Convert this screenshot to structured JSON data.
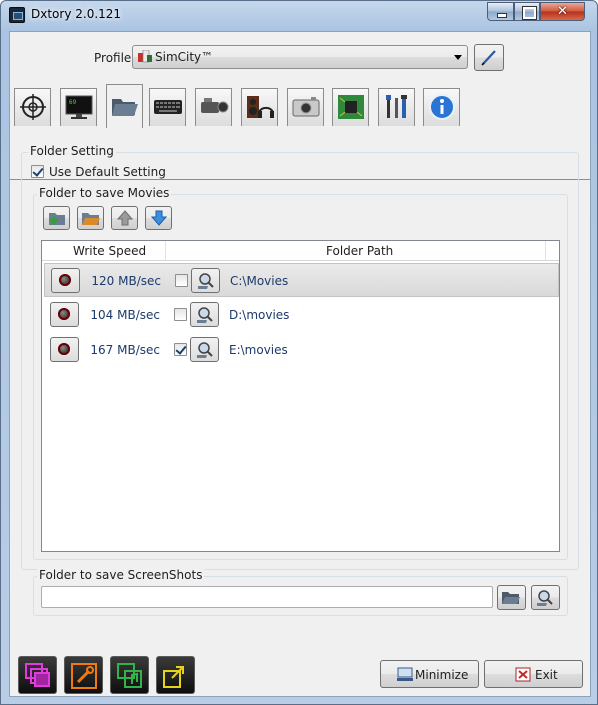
{
  "window": {
    "title": "Dxtory 2.0.121"
  },
  "profile": {
    "label": "Profile",
    "value": "SimCity™"
  },
  "tabs": [
    {
      "name": "capture-target-tab"
    },
    {
      "name": "display-overlay-tab"
    },
    {
      "name": "folder-tab",
      "active": true
    },
    {
      "name": "hotkey-tab"
    },
    {
      "name": "movie-setting-tab"
    },
    {
      "name": "audio-setting-tab"
    },
    {
      "name": "screenshot-setting-tab"
    },
    {
      "name": "advanced-setting-tab"
    },
    {
      "name": "environment-setting-tab"
    },
    {
      "name": "info-tab"
    }
  ],
  "folder_setting": {
    "title": "Folder Setting",
    "use_default_label": "Use Default Setting",
    "use_default_checked": true
  },
  "movies": {
    "title": "Folder to save Movies",
    "columns": {
      "write_speed": "Write Speed",
      "folder_path": "Folder Path"
    },
    "rows": [
      {
        "speed": "120 MB/sec",
        "checked": false,
        "path": "C:\\Movies",
        "selected": true
      },
      {
        "speed": "104 MB/sec",
        "checked": false,
        "path": "D:\\movies",
        "selected": false
      },
      {
        "speed": "167 MB/sec",
        "checked": true,
        "path": "E:\\movies",
        "selected": false
      }
    ]
  },
  "screenshots": {
    "title": "Folder to save ScreenShots",
    "value": ""
  },
  "buttons": {
    "minimize": "Minimize",
    "exit": "Exit"
  }
}
